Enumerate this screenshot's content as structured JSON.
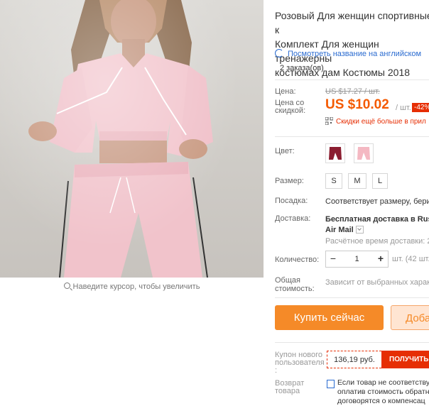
{
  "image": {
    "zoom_hint": "Наведите курсор, чтобы увеличить"
  },
  "product": {
    "title_line1": "Розовый Для женщин спортивные к",
    "title_line2": "Комплект Для женщин тренажерны",
    "title_line3": "костюмах дам Костюмы 2018",
    "translate_link": "Посмотреть название на английском",
    "orders": "2 заказа(ов)"
  },
  "price": {
    "label": "Цена:",
    "old": "US $17.27 / шт.",
    "discount_label_line1": "Цена со",
    "discount_label_line2": "скидкой:",
    "new": "US $10.02",
    "per_unit": "/ шт.",
    "discount": "-42%",
    "more_discounts": "Скидки ещё больше в прил"
  },
  "options": {
    "color_label": "Цвет:",
    "size_label": "Размер:",
    "sizes": [
      "S",
      "M",
      "L"
    ],
    "fit_label": "Посадка:",
    "fit_value": "Соответствует размеру, берите",
    "delivery_label": "Доставка:",
    "delivery_line1": "Бесплатная доставка в Russ",
    "delivery_line2": "Air Mail",
    "delivery_time": "Расчётное время доставки: 20",
    "quantity_label": "Количество:",
    "quantity_value": "1",
    "quantity_units": "шт. (42 шт.",
    "total_label_line1": "Общая",
    "total_label_line2": "стоимость:",
    "total_value": "Зависит от выбранных характ"
  },
  "actions": {
    "buy_now": "Купить сейчас",
    "add_to_cart": "Доба"
  },
  "coupon": {
    "label_line1": "Купон нового",
    "label_line2": "пользователя",
    "label_line3": ":",
    "value": "136,19 руб.",
    "button": "ПОЛУЧИТЬ"
  },
  "returns": {
    "label_line1": "Возврат",
    "label_line2": "товара",
    "text_line1": "Если товар не соответству",
    "text_line2": "оплатив стоимость обратн",
    "text_line3": "договорятся о компенсац"
  },
  "colors": {
    "accent": "#f58a28",
    "price": "#f45a00",
    "sale": "#e62e04",
    "link": "#2a6bd0"
  }
}
